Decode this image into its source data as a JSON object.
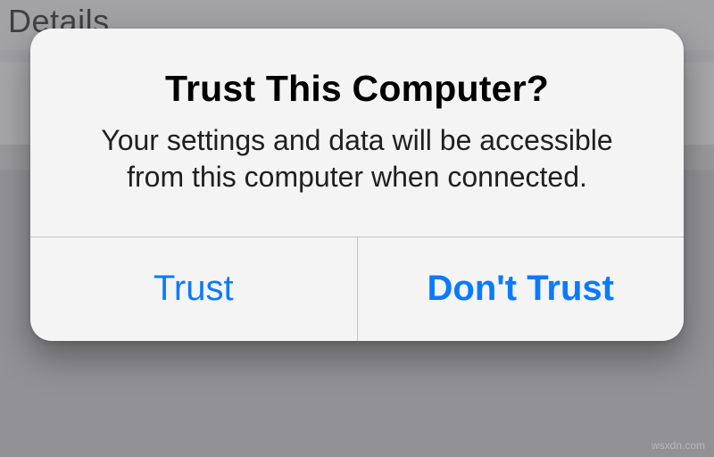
{
  "background": {
    "header_text": "e Details"
  },
  "alert": {
    "title": "Trust This Computer?",
    "message": "Your settings and data will be accessible from this computer when connected.",
    "buttons": {
      "trust": "Trust",
      "dont_trust": "Don't Trust"
    }
  },
  "watermark": "wsxdn.com"
}
